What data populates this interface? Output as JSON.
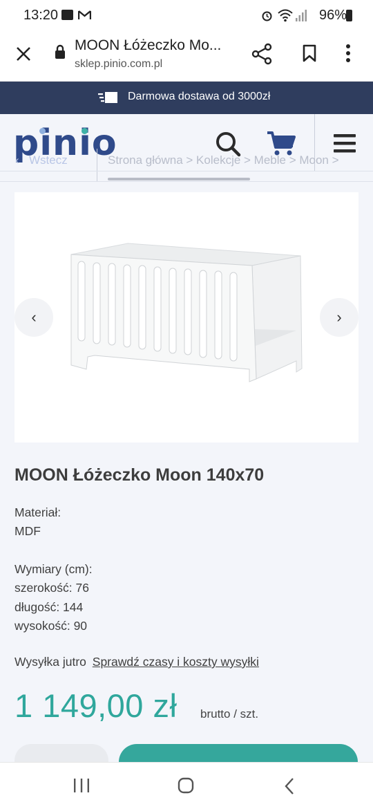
{
  "status_bar": {
    "time": "13:20",
    "battery": "96%"
  },
  "browser": {
    "page_title": "MOON Łóżeczko Mo...",
    "url": "sklep.pinio.com.pl"
  },
  "promo": {
    "text": "Darmowa dostawa od 3000zł"
  },
  "header": {
    "logo": "pinio",
    "back_label": "Wstecz",
    "breadcrumb": "Strona główna > Kolekcje > Meble > Moon >"
  },
  "product": {
    "title": "MOON Łóżeczko Moon 140x70",
    "material_label": "Materiał:",
    "material_value": "MDF",
    "dimensions_label": "Wymiary (cm):",
    "width": "szerokość: 76",
    "length": "długość: 144",
    "height": "wysokość: 90",
    "shipping_text": "Wysyłka jutro",
    "shipping_link": "Sprawdź czasy i koszty wysyłki",
    "price": "1 149,00 zł",
    "price_unit": "brutto / szt."
  },
  "colors": {
    "accent": "#2fa79c",
    "navy": "#2f3d5e",
    "logo_blue": "#2f4a8a"
  }
}
